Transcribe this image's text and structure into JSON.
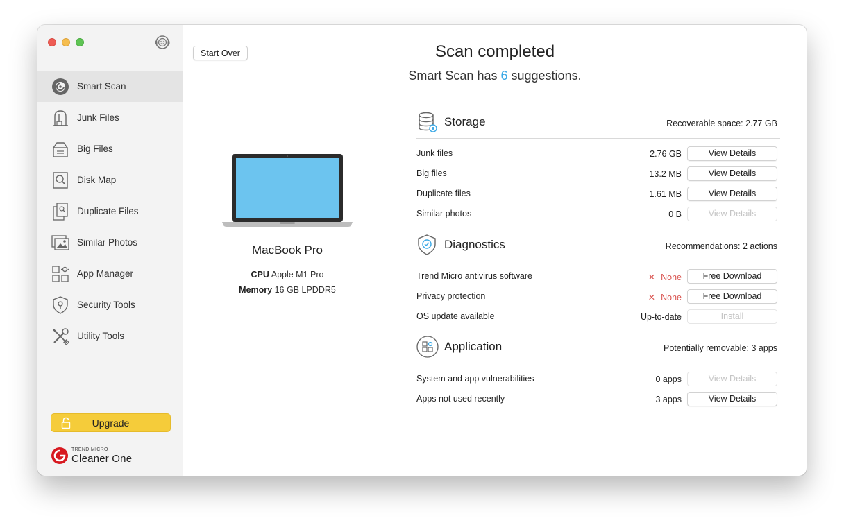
{
  "sidebar": {
    "items": [
      {
        "label": "Smart Scan",
        "icon": "smart-scan-icon",
        "active": true
      },
      {
        "label": "Junk Files",
        "icon": "vacuum-icon"
      },
      {
        "label": "Big Files",
        "icon": "big-files-icon"
      },
      {
        "label": "Disk Map",
        "icon": "disk-map-icon"
      },
      {
        "label": "Duplicate Files",
        "icon": "duplicate-files-icon"
      },
      {
        "label": "Similar Photos",
        "icon": "photos-icon"
      },
      {
        "label": "App Manager",
        "icon": "app-manager-icon"
      },
      {
        "label": "Security Tools",
        "icon": "shield-icon"
      },
      {
        "label": "Utility Tools",
        "icon": "tools-icon"
      }
    ],
    "upgrade_label": "Upgrade",
    "brand_top": "TREND MICRO",
    "brand_name": "Cleaner One"
  },
  "header": {
    "start_over_label": "Start Over",
    "title": "Scan completed",
    "subtitle_prefix": "Smart Scan has",
    "suggestion_count": "6",
    "subtitle_suffix": "suggestions."
  },
  "device": {
    "name": "MacBook Pro",
    "cpu_label": "CPU",
    "cpu_value": "Apple M1 Pro",
    "memory_label": "Memory",
    "memory_value": "16 GB LPDDR5"
  },
  "storage": {
    "title": "Storage",
    "summary": "Recoverable space: 2.77 GB",
    "rows": [
      {
        "label": "Junk files",
        "value": "2.76 GB",
        "button": "View Details",
        "enabled": true
      },
      {
        "label": "Big files",
        "value": "13.2 MB",
        "button": "View Details",
        "enabled": true
      },
      {
        "label": "Duplicate files",
        "value": "1.61 MB",
        "button": "View Details",
        "enabled": true
      },
      {
        "label": "Similar photos",
        "value": "0 B",
        "button": "View Details",
        "enabled": false
      }
    ]
  },
  "diagnostics": {
    "title": "Diagnostics",
    "summary": "Recommendations: 2 actions",
    "rows": [
      {
        "label": "Trend Micro antivirus software",
        "value": "None",
        "button": "Free Download",
        "enabled": true
      },
      {
        "label": "Privacy protection",
        "value": "None",
        "button": "Free Download",
        "enabled": true
      },
      {
        "label": "OS update available",
        "value": "Up-to-date",
        "button": "Install",
        "enabled": false
      }
    ]
  },
  "application": {
    "title": "Application",
    "summary": "Potentially removable: 3 apps",
    "rows": [
      {
        "label": "System and app vulnerabilities",
        "value": "0 apps",
        "button": "View Details",
        "enabled": false
      },
      {
        "label": "Apps not used recently",
        "value": "3 apps",
        "button": "View Details",
        "enabled": true
      }
    ]
  },
  "colors": {
    "accent": "#3ba9e6",
    "upgrade": "#f5cc3a",
    "warning": "#d9534f"
  }
}
